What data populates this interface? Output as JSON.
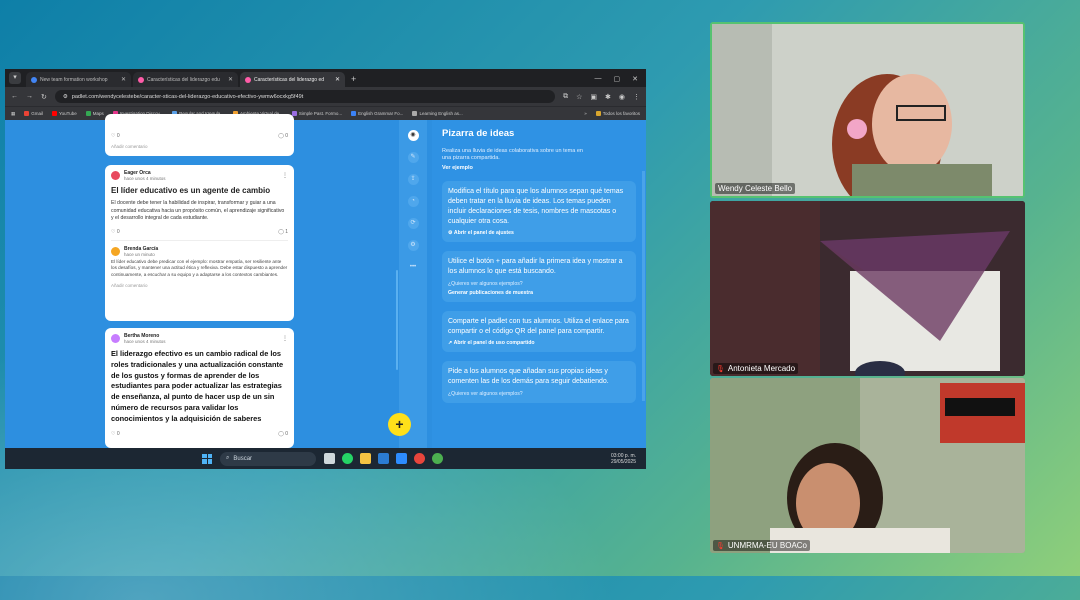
{
  "browser": {
    "tabs": [
      {
        "label": "New team formation workshop",
        "active": false,
        "color": "#4285f4"
      },
      {
        "label": "Características del liderazgo edu",
        "active": false,
        "color": "#ff5ca8"
      },
      {
        "label": "Características del liderazgo ed",
        "active": true,
        "color": "#ff5ca8"
      }
    ],
    "url": "padlet.com/wendycelestebe/caracter-sticas-del-liderazgo-educativo-efectivo-ywmw6ocxkg5f49t",
    "bookmarks": [
      "Gmail",
      "YouTube",
      "Maps",
      "Investigation Discov...",
      "Regular and Irregula...",
      "Ambiente Virtual de...",
      "Simple Past. Formo...",
      "English Grammar Fo...",
      "Learning English as..."
    ],
    "bookmarks_all": "Todos los favoritos"
  },
  "padlet": {
    "card_top": {
      "likes": "0",
      "comments": "0",
      "add_comment": "Añadir comentario"
    },
    "card1": {
      "author": "Eager Orca",
      "time": "hace unos 4 minutos",
      "title": "El líder educativo es un agente de cambio",
      "body": "El docente debe tener la habilidad de inspirar, transformar y guiar a una comunidad educativa hacia un propósito común, el aprendizaje significativo y el desarrollo integral de cada estudiante.",
      "likes": "0",
      "comments": "1",
      "reply_author": "Brenda García",
      "reply_time": "hace un minuto",
      "reply_body": "El líder educativo debe predicar con el ejemplo: mostrar empatía, ser resiliente ante los desafíos, y mantener una actitud ética y reflexiva. Debe estar dispuesto a aprender continuamente, a escuchar a su equipo y a adaptarse a los contextos cambiantes.",
      "add_comment": "Añadir comentario"
    },
    "card2": {
      "author": "Bertha Moreno",
      "time": "hace unos 4 minutos",
      "body": "El liderazgo efectivo es un cambio radical de los roles tradicionales y una actualización constante de los gustos y formas de aprender de los estudiantes para poder actualizar las estrategias de enseñanza, al punto de hacer usp de un sin número de recursos para validar los conocimientos y la adquisición de saberes",
      "likes": "0",
      "comments": "0"
    },
    "fab": "+",
    "panel": {
      "title": "Pizarra de ideas",
      "desc": "Realiza una lluvia de ideas colaborativa sobre un tema en una pizarra compartida.",
      "link": "Ver ejemplo",
      "boxes": [
        {
          "text": "Modifica el título para que los alumnos sepan qué temas deben tratar en la lluvia de ideas. Los temas pueden incluir declaraciones de tesis, nombres de mascotas o cualquier otra cosa.",
          "sub": "",
          "action": "Abrir el panel de ajustes"
        },
        {
          "text": "Utilice el botón + para añadir la primera idea y mostrar a los alumnos lo que está buscando.",
          "sub": "¿Quieres ver algunos ejemplos?",
          "action": "Generar publicaciones de muestra"
        },
        {
          "text": "Comparte el padlet con tus alumnos. Utiliza el enlace para compartir o el código QR del panel para compartir.",
          "sub": "",
          "action": "Abrir el panel de uso compartido"
        },
        {
          "text": "Pide a los alumnos que añadan sus propias ideas y comenten las de los demás para seguir debatiendo.",
          "sub": "¿Quieres ver algunos ejemplos?",
          "action": ""
        }
      ]
    }
  },
  "taskbar": {
    "search": "Buscar",
    "time": "03:00 p. m.",
    "date": "29/05/2025"
  },
  "participants": [
    "Wendy Celeste Bello",
    "Antonieta Mercado",
    "UNMRMA-EU BOACo"
  ]
}
